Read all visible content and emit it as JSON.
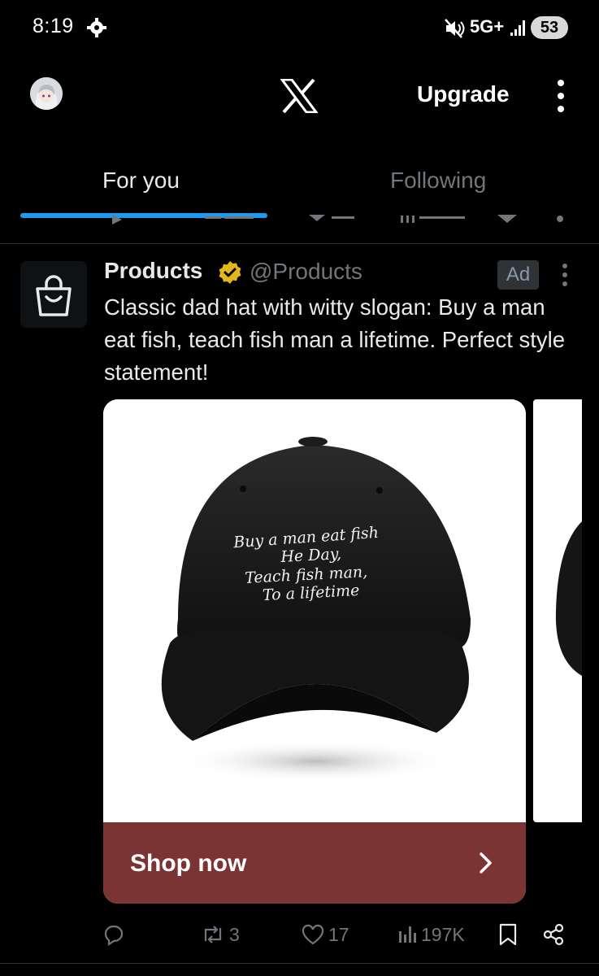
{
  "status_bar": {
    "time": "8:19",
    "network": "5G+",
    "battery": "53",
    "icons": [
      "gear-icon",
      "mute-icon",
      "signal-icon",
      "battery-icon"
    ]
  },
  "header": {
    "upgrade_label": "Upgrade",
    "icons": [
      "avatar",
      "x-logo-icon",
      "more-vertical-icon"
    ]
  },
  "tabs": [
    {
      "label": "For you",
      "active": true
    },
    {
      "label": "Following",
      "active": false
    }
  ],
  "post": {
    "author_name": "Products",
    "handle": "@Products",
    "ad_label": "Ad",
    "text": "Classic dad hat with witty slogan: Buy a man eat fish, teach fish man a lifetime. Perfect style statement!",
    "hat_text": {
      "line1": "Buy a man eat fish",
      "line2": "He Day,",
      "line3": "Teach fish man,",
      "line4": "To a lifetime"
    },
    "cta_label": "Shop now",
    "actions": {
      "reposts": "3",
      "likes": "17",
      "views": "197K"
    }
  },
  "colors": {
    "background": "#000000",
    "accent": "#1d9bf0",
    "verified": "#e2b719",
    "cta_background": "#7a3434",
    "muted_text": "#71767b"
  }
}
